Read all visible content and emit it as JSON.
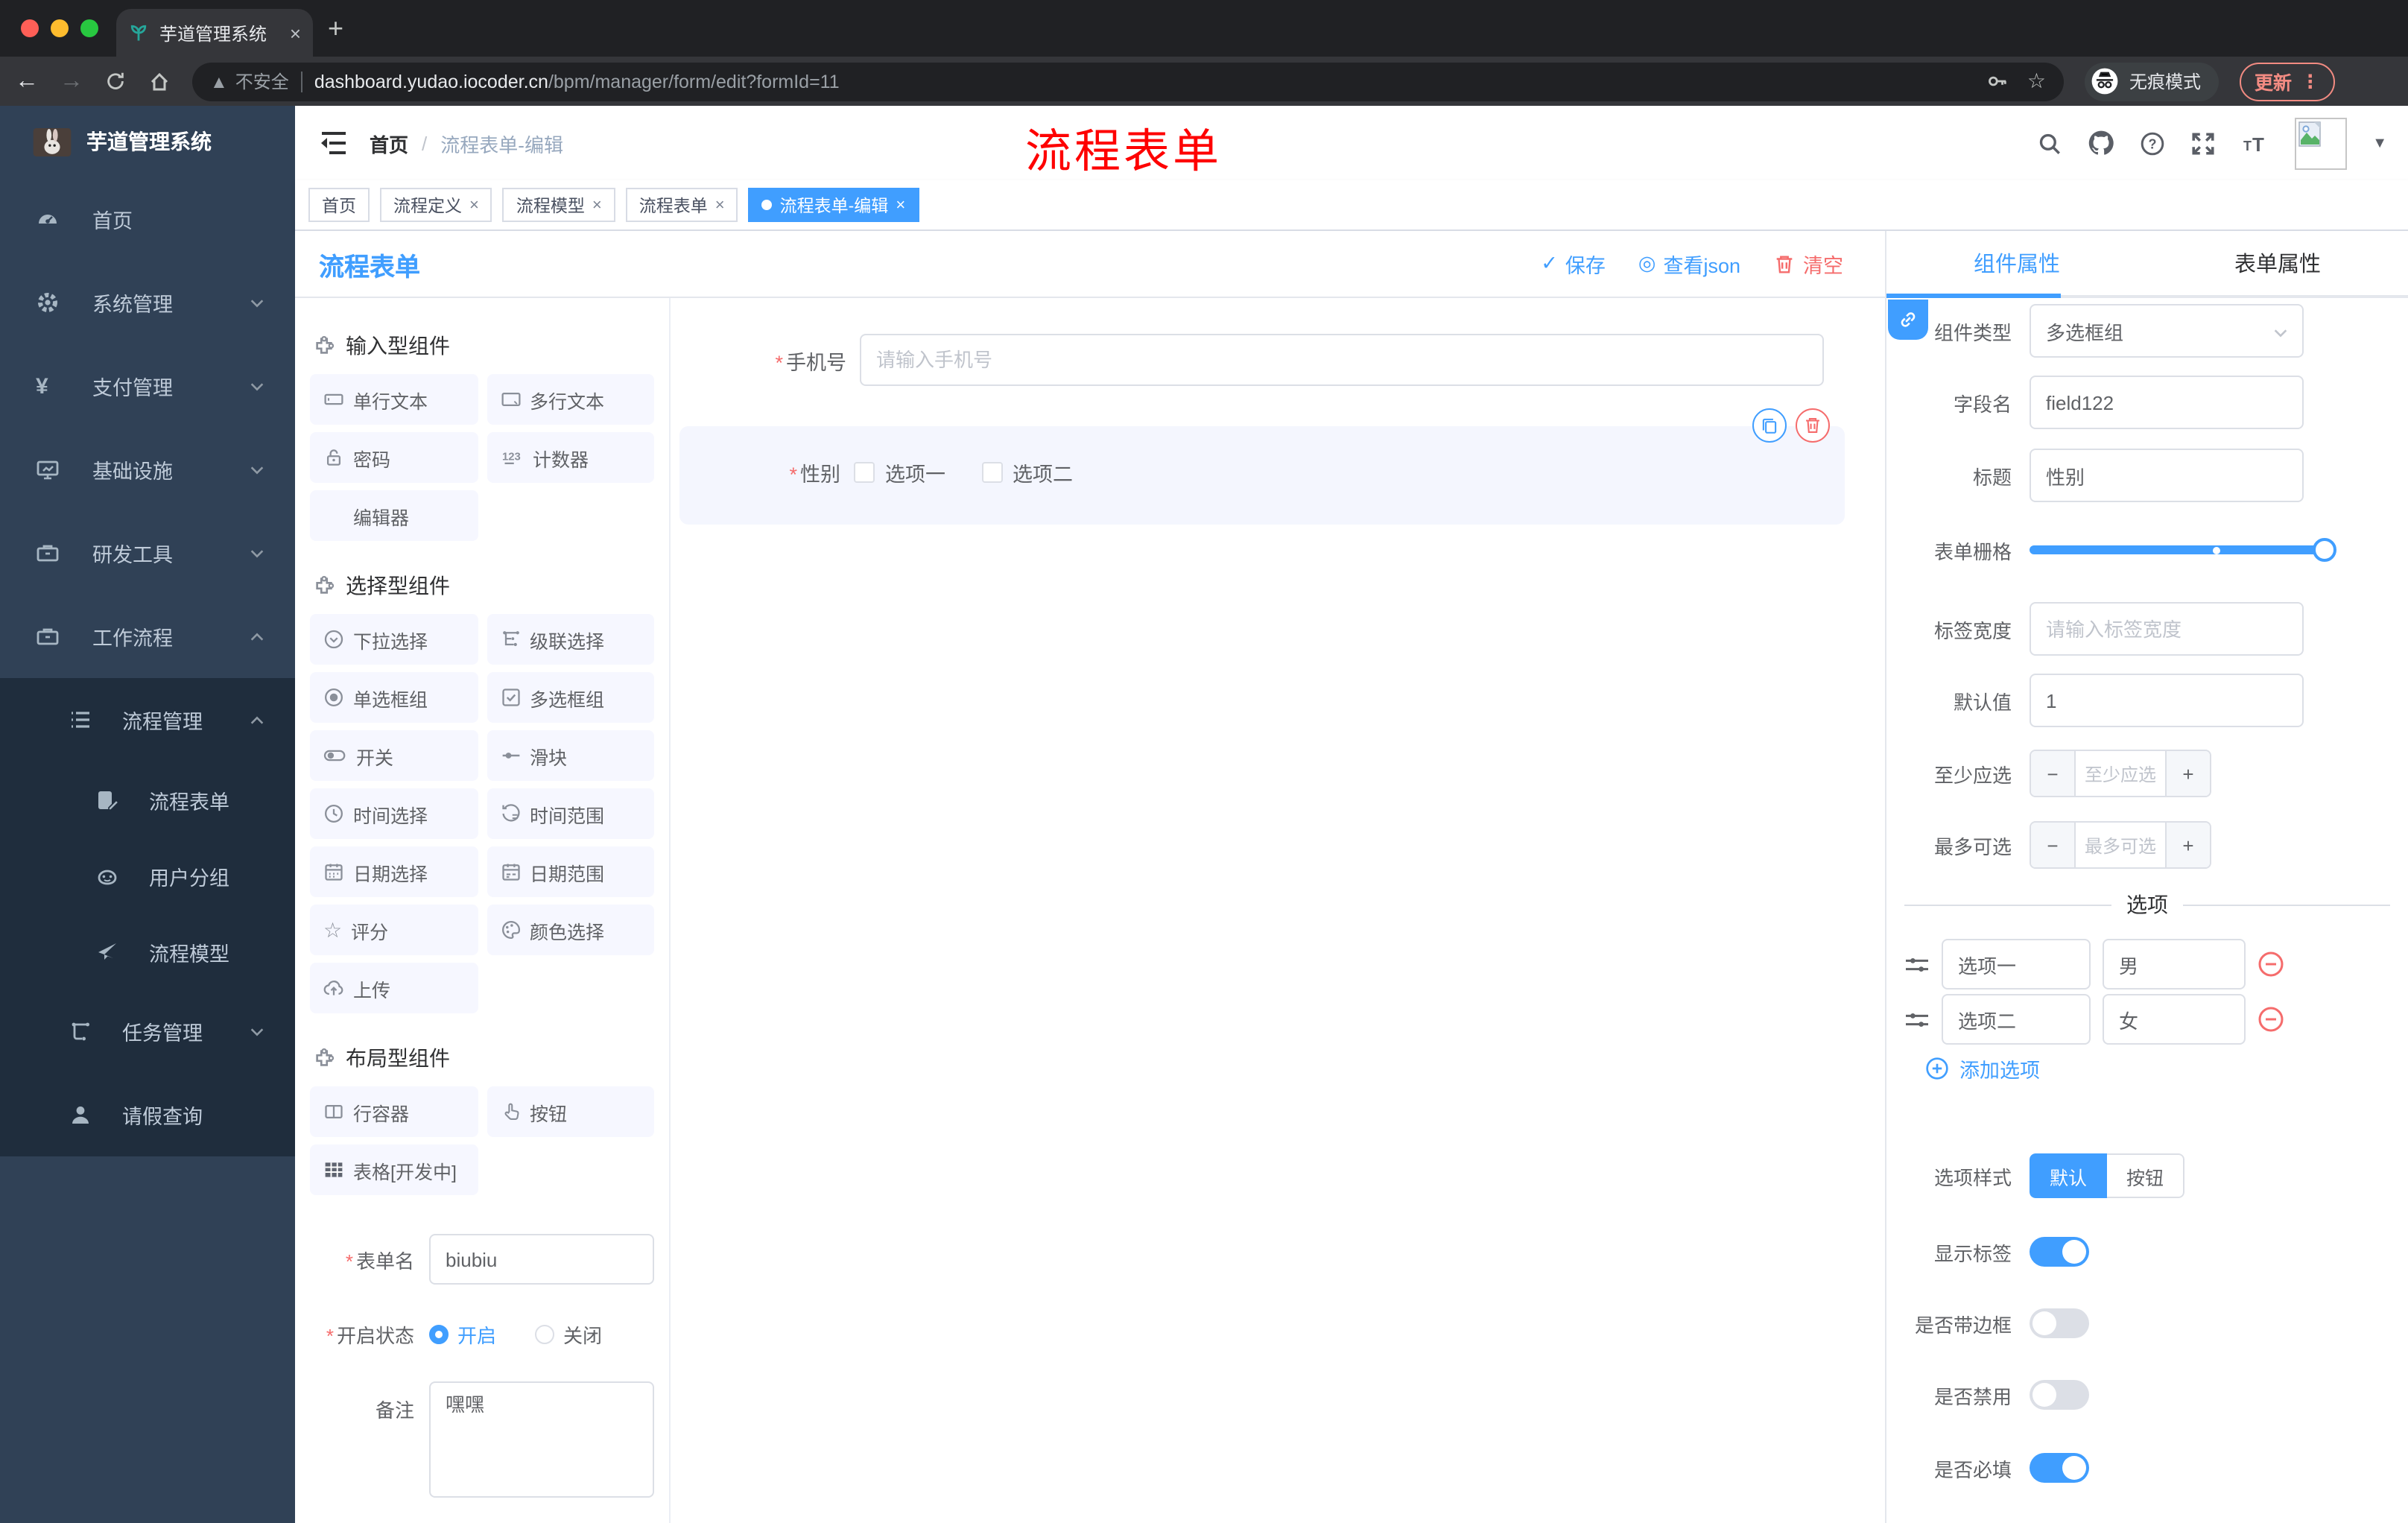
{
  "browser": {
    "tab_title": "芋道管理系统",
    "new_tab": "+",
    "close_tab": "×",
    "security_label": "不安全",
    "url_domain": "dashboard.yudao.iocoder.cn",
    "url_path": "/bpm/manager/form/edit?formId=11",
    "incognito_label": "无痕模式",
    "update_label": "更新",
    "colors": {
      "traffic_red": "#ff5f57",
      "traffic_yellow": "#febc2e",
      "traffic_green": "#28c840",
      "update": "#f28b82"
    }
  },
  "sidebar": {
    "logo_title": "芋道管理系统",
    "items": [
      {
        "label": "首页",
        "icon": "dashboard-icon"
      },
      {
        "label": "系统管理",
        "icon": "gear-icon"
      },
      {
        "label": "支付管理",
        "icon": "yen-icon"
      },
      {
        "label": "基础设施",
        "icon": "monitor-icon"
      },
      {
        "label": "研发工具",
        "icon": "toolbox-icon"
      },
      {
        "label": "工作流程",
        "icon": "briefcase-icon"
      }
    ],
    "submenu": [
      {
        "label": "流程管理",
        "icon": "tree-list-icon"
      },
      {
        "label": "流程表单",
        "icon": "doc-edit-icon"
      },
      {
        "label": "用户分组",
        "icon": "robot-icon"
      },
      {
        "label": "流程模型",
        "icon": "send-icon"
      },
      {
        "label": "任务管理",
        "icon": "tree-icon"
      },
      {
        "label": "请假查询",
        "icon": "user-icon"
      }
    ]
  },
  "navbar": {
    "breadcrumb_home": "首页",
    "breadcrumb_sep": "/",
    "breadcrumb_current": "流程表单-编辑",
    "annotation": "流程表单"
  },
  "tags": [
    {
      "label": "首页"
    },
    {
      "label": "流程定义",
      "close": "×"
    },
    {
      "label": "流程模型",
      "close": "×"
    },
    {
      "label": "流程表单",
      "close": "×"
    },
    {
      "label": "流程表单-编辑",
      "close": "×"
    }
  ],
  "builder": {
    "title": "流程表单",
    "actions": {
      "save": "保存",
      "view_json": "查看json",
      "view_json_icon": "◎",
      "clear": "清空",
      "check_icon": "✓"
    },
    "palette": {
      "groups": [
        {
          "title": "输入型组件",
          "items": [
            {
              "label": "单行文本"
            },
            {
              "label": "多行文本"
            },
            {
              "label": "密码"
            },
            {
              "label": "计数器"
            },
            {
              "label": "编辑器"
            }
          ]
        },
        {
          "title": "选择型组件",
          "items": [
            {
              "label": "下拉选择"
            },
            {
              "label": "级联选择"
            },
            {
              "label": "单选框组"
            },
            {
              "label": "多选框组"
            },
            {
              "label": "开关"
            },
            {
              "label": "滑块"
            },
            {
              "label": "时间选择"
            },
            {
              "label": "时间范围"
            },
            {
              "label": "日期选择"
            },
            {
              "label": "日期范围"
            },
            {
              "label": "评分"
            },
            {
              "label": "颜色选择"
            },
            {
              "label": "上传"
            }
          ]
        },
        {
          "title": "布局型组件",
          "items": [
            {
              "label": "行容器"
            },
            {
              "label": "按钮"
            },
            {
              "label": "表格[开发中]"
            }
          ]
        }
      ]
    },
    "form_meta": {
      "name_label": "表单名",
      "name_value": "biubiu",
      "status_label": "开启状态",
      "status_on": "开启",
      "status_off": "关闭",
      "remark_label": "备注",
      "remark_value": "嘿嘿"
    },
    "canvas": {
      "phone_label": "手机号",
      "phone_placeholder": "请输入手机号",
      "gender_label": "性别",
      "gender_option1": "选项一",
      "gender_option2": "选项二"
    }
  },
  "inspector": {
    "tab_component": "组件属性",
    "tab_form": "表单属性",
    "fields": {
      "component_type": {
        "label": "组件类型",
        "value": "多选框组"
      },
      "field_name": {
        "label": "字段名",
        "value": "field122"
      },
      "title": {
        "label": "标题",
        "value": "性别"
      },
      "grid": {
        "label": "表单栅格"
      },
      "label_width": {
        "label": "标签宽度",
        "placeholder": "请输入标签宽度"
      },
      "default_value": {
        "label": "默认值",
        "value": "1"
      },
      "min_select": {
        "label": "至少应选",
        "placeholder": "至少应选"
      },
      "max_select": {
        "label": "最多可选",
        "placeholder": "最多可选"
      }
    },
    "options_section": {
      "title": "选项",
      "rows": [
        {
          "label": "选项一",
          "value": "男"
        },
        {
          "label": "选项二",
          "value": "女"
        }
      ],
      "add_label": "添加选项"
    },
    "style_section": {
      "option_style_label": "选项样式",
      "style_default": "默认",
      "style_button": "按钮",
      "toggle_show_label": "显示标签",
      "toggle_border": "是否带边框",
      "toggle_disabled": "是否禁用",
      "toggle_required": "是否必填"
    },
    "colors": {
      "accent": "#409EFF",
      "danger": "#F56C6C"
    }
  }
}
